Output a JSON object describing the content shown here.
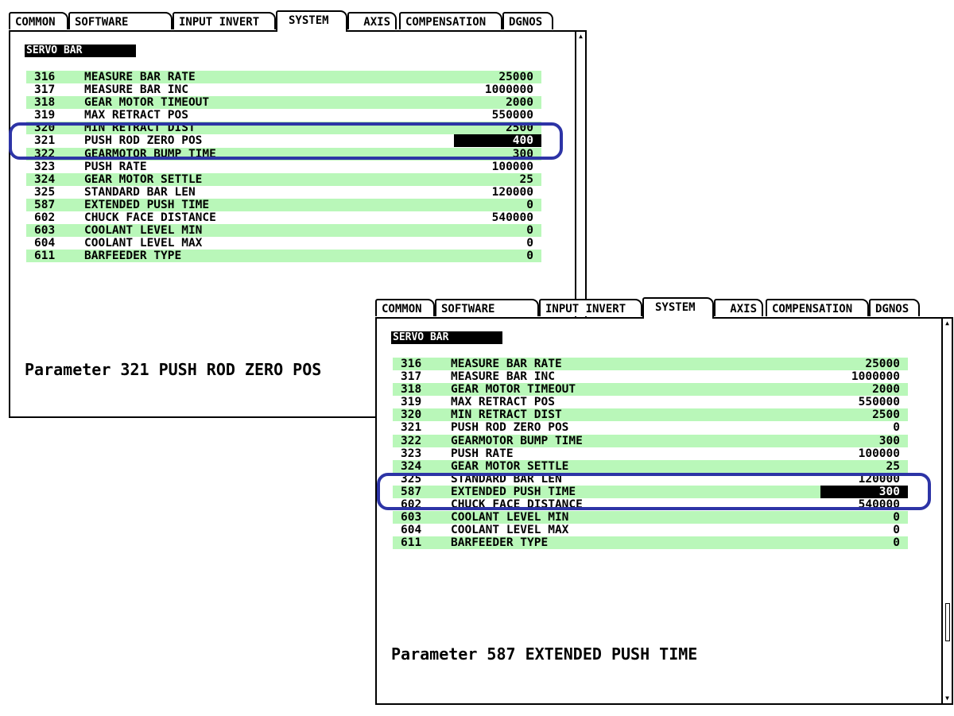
{
  "tabs": [
    "COMMON",
    "SOFTWARE",
    "INPUT INVERT",
    "SYSTEM",
    "AXIS",
    "COMPENSATION",
    "DGNOS"
  ],
  "active_tab": "SYSTEM",
  "section_title": "SERVO BAR",
  "scroll_arrows": {
    "up": "▲",
    "down": "▼"
  },
  "colors": {
    "row_highlight": "#b9f7b9",
    "annotation_oval": "#2d34a6",
    "selection": "#000000"
  },
  "panels": [
    {
      "selected_param": "321",
      "caption": "Parameter 321 PUSH ROD ZERO POS",
      "rows": [
        {
          "num": "316",
          "name": "MEASURE BAR RATE",
          "value": "25000"
        },
        {
          "num": "317",
          "name": "MEASURE BAR INC",
          "value": "1000000"
        },
        {
          "num": "318",
          "name": "GEAR MOTOR TIMEOUT",
          "value": "2000"
        },
        {
          "num": "319",
          "name": "MAX RETRACT POS",
          "value": "550000"
        },
        {
          "num": "320",
          "name": "MIN RETRACT DIST",
          "value": "2500"
        },
        {
          "num": "321",
          "name": "PUSH ROD ZERO POS",
          "value": "400"
        },
        {
          "num": "322",
          "name": "GEARMOTOR BUMP TIME",
          "value": "300"
        },
        {
          "num": "323",
          "name": "PUSH RATE",
          "value": "100000"
        },
        {
          "num": "324",
          "name": "GEAR MOTOR SETTLE",
          "value": "25"
        },
        {
          "num": "325",
          "name": "STANDARD BAR LEN",
          "value": "120000"
        },
        {
          "num": "587",
          "name": "EXTENDED PUSH TIME",
          "value": "0"
        },
        {
          "num": "602",
          "name": "CHUCK FACE DISTANCE",
          "value": "540000"
        },
        {
          "num": "603",
          "name": "COOLANT LEVEL MIN",
          "value": "0"
        },
        {
          "num": "604",
          "name": "COOLANT LEVEL MAX",
          "value": "0"
        },
        {
          "num": "611",
          "name": "BARFEEDER TYPE",
          "value": "0"
        }
      ]
    },
    {
      "selected_param": "587",
      "caption": "Parameter 587 EXTENDED PUSH TIME",
      "rows": [
        {
          "num": "316",
          "name": "MEASURE BAR RATE",
          "value": "25000"
        },
        {
          "num": "317",
          "name": "MEASURE BAR INC",
          "value": "1000000"
        },
        {
          "num": "318",
          "name": "GEAR MOTOR TIMEOUT",
          "value": "2000"
        },
        {
          "num": "319",
          "name": "MAX RETRACT POS",
          "value": "550000"
        },
        {
          "num": "320",
          "name": "MIN RETRACT DIST",
          "value": "2500"
        },
        {
          "num": "321",
          "name": "PUSH ROD ZERO POS",
          "value": "0"
        },
        {
          "num": "322",
          "name": "GEARMOTOR BUMP TIME",
          "value": "300"
        },
        {
          "num": "323",
          "name": "PUSH RATE",
          "value": "100000"
        },
        {
          "num": "324",
          "name": "GEAR MOTOR SETTLE",
          "value": "25"
        },
        {
          "num": "325",
          "name": "STANDARD BAR LEN",
          "value": "120000"
        },
        {
          "num": "587",
          "name": "EXTENDED PUSH TIME",
          "value": "300"
        },
        {
          "num": "602",
          "name": "CHUCK FACE DISTANCE",
          "value": "540000"
        },
        {
          "num": "603",
          "name": "COOLANT LEVEL MIN",
          "value": "0"
        },
        {
          "num": "604",
          "name": "COOLANT LEVEL MAX",
          "value": "0"
        },
        {
          "num": "611",
          "name": "BARFEEDER TYPE",
          "value": "0"
        }
      ]
    }
  ]
}
